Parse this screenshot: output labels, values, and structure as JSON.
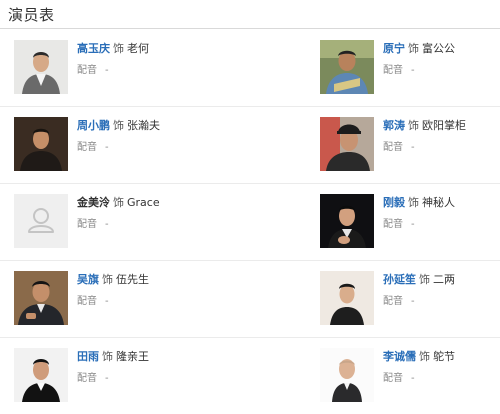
{
  "section": {
    "title": "演员表"
  },
  "cast": [
    {
      "actor": "高玉庆",
      "linked": true,
      "role_word": "饰",
      "role": "老何",
      "dub_label": "配音",
      "dub_value": "-",
      "photo": "actor-photo"
    },
    {
      "actor": "原宁",
      "linked": true,
      "role_word": "饰",
      "role": "富公公",
      "dub_label": "配音",
      "dub_value": "-",
      "photo": "actor-photo"
    },
    {
      "actor": "周小鹏",
      "linked": true,
      "role_word": "饰",
      "role": "张瀚夫",
      "dub_label": "配音",
      "dub_value": "-",
      "photo": "actor-photo"
    },
    {
      "actor": "郭涛",
      "linked": true,
      "role_word": "饰",
      "role": "欧阳掌柜",
      "dub_label": "配音",
      "dub_value": "-",
      "photo": "actor-photo"
    },
    {
      "actor": "金美泠",
      "linked": false,
      "role_word": "饰",
      "role": "Grace",
      "dub_label": "配音",
      "dub_value": "-",
      "photo": "placeholder-avatar-icon"
    },
    {
      "actor": "刚毅",
      "linked": true,
      "role_word": "饰",
      "role": "神秘人",
      "dub_label": "配音",
      "dub_value": "-",
      "photo": "actor-photo"
    },
    {
      "actor": "吴旗",
      "linked": true,
      "role_word": "饰",
      "role": "伍先生",
      "dub_label": "配音",
      "dub_value": "-",
      "photo": "actor-photo"
    },
    {
      "actor": "孙延笙",
      "linked": true,
      "role_word": "饰",
      "role": "二两",
      "dub_label": "配音",
      "dub_value": "-",
      "photo": "actor-photo"
    },
    {
      "actor": "田雨",
      "linked": true,
      "role_word": "饰",
      "role": "隆亲王",
      "dub_label": "配音",
      "dub_value": "-",
      "photo": "actor-photo"
    },
    {
      "actor": "李诚儒",
      "linked": true,
      "role_word": "饰",
      "role": "鸵节",
      "dub_label": "配音",
      "dub_value": "-",
      "photo": "actor-photo"
    }
  ],
  "colors": {
    "link": "#2a6eb8",
    "text": "#333333",
    "muted": "#888888",
    "divider": "#ebebeb"
  }
}
